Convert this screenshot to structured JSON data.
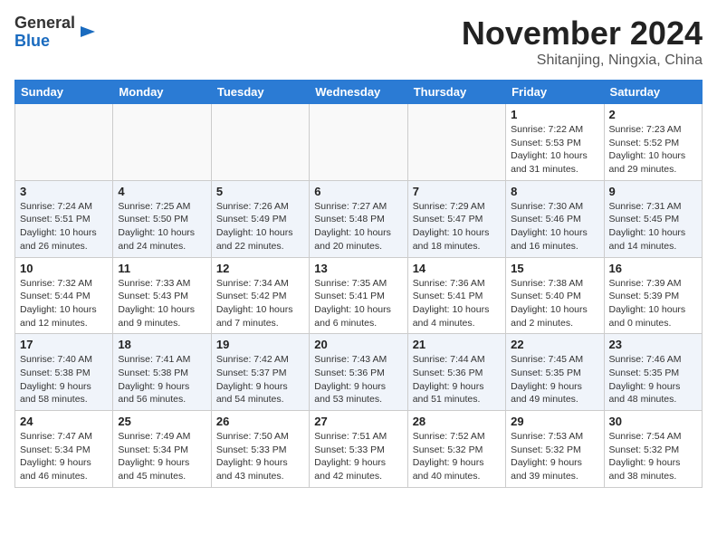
{
  "header": {
    "logo_line1": "General",
    "logo_line2": "Blue",
    "month_year": "November 2024",
    "location": "Shitanjing, Ningxia, China"
  },
  "calendar": {
    "days_of_week": [
      "Sunday",
      "Monday",
      "Tuesday",
      "Wednesday",
      "Thursday",
      "Friday",
      "Saturday"
    ],
    "weeks": [
      [
        {
          "day": "",
          "info": ""
        },
        {
          "day": "",
          "info": ""
        },
        {
          "day": "",
          "info": ""
        },
        {
          "day": "",
          "info": ""
        },
        {
          "day": "",
          "info": ""
        },
        {
          "day": "1",
          "info": "Sunrise: 7:22 AM\nSunset: 5:53 PM\nDaylight: 10 hours and 31 minutes."
        },
        {
          "day": "2",
          "info": "Sunrise: 7:23 AM\nSunset: 5:52 PM\nDaylight: 10 hours and 29 minutes."
        }
      ],
      [
        {
          "day": "3",
          "info": "Sunrise: 7:24 AM\nSunset: 5:51 PM\nDaylight: 10 hours and 26 minutes."
        },
        {
          "day": "4",
          "info": "Sunrise: 7:25 AM\nSunset: 5:50 PM\nDaylight: 10 hours and 24 minutes."
        },
        {
          "day": "5",
          "info": "Sunrise: 7:26 AM\nSunset: 5:49 PM\nDaylight: 10 hours and 22 minutes."
        },
        {
          "day": "6",
          "info": "Sunrise: 7:27 AM\nSunset: 5:48 PM\nDaylight: 10 hours and 20 minutes."
        },
        {
          "day": "7",
          "info": "Sunrise: 7:29 AM\nSunset: 5:47 PM\nDaylight: 10 hours and 18 minutes."
        },
        {
          "day": "8",
          "info": "Sunrise: 7:30 AM\nSunset: 5:46 PM\nDaylight: 10 hours and 16 minutes."
        },
        {
          "day": "9",
          "info": "Sunrise: 7:31 AM\nSunset: 5:45 PM\nDaylight: 10 hours and 14 minutes."
        }
      ],
      [
        {
          "day": "10",
          "info": "Sunrise: 7:32 AM\nSunset: 5:44 PM\nDaylight: 10 hours and 12 minutes."
        },
        {
          "day": "11",
          "info": "Sunrise: 7:33 AM\nSunset: 5:43 PM\nDaylight: 10 hours and 9 minutes."
        },
        {
          "day": "12",
          "info": "Sunrise: 7:34 AM\nSunset: 5:42 PM\nDaylight: 10 hours and 7 minutes."
        },
        {
          "day": "13",
          "info": "Sunrise: 7:35 AM\nSunset: 5:41 PM\nDaylight: 10 hours and 6 minutes."
        },
        {
          "day": "14",
          "info": "Sunrise: 7:36 AM\nSunset: 5:41 PM\nDaylight: 10 hours and 4 minutes."
        },
        {
          "day": "15",
          "info": "Sunrise: 7:38 AM\nSunset: 5:40 PM\nDaylight: 10 hours and 2 minutes."
        },
        {
          "day": "16",
          "info": "Sunrise: 7:39 AM\nSunset: 5:39 PM\nDaylight: 10 hours and 0 minutes."
        }
      ],
      [
        {
          "day": "17",
          "info": "Sunrise: 7:40 AM\nSunset: 5:38 PM\nDaylight: 9 hours and 58 minutes."
        },
        {
          "day": "18",
          "info": "Sunrise: 7:41 AM\nSunset: 5:38 PM\nDaylight: 9 hours and 56 minutes."
        },
        {
          "day": "19",
          "info": "Sunrise: 7:42 AM\nSunset: 5:37 PM\nDaylight: 9 hours and 54 minutes."
        },
        {
          "day": "20",
          "info": "Sunrise: 7:43 AM\nSunset: 5:36 PM\nDaylight: 9 hours and 53 minutes."
        },
        {
          "day": "21",
          "info": "Sunrise: 7:44 AM\nSunset: 5:36 PM\nDaylight: 9 hours and 51 minutes."
        },
        {
          "day": "22",
          "info": "Sunrise: 7:45 AM\nSunset: 5:35 PM\nDaylight: 9 hours and 49 minutes."
        },
        {
          "day": "23",
          "info": "Sunrise: 7:46 AM\nSunset: 5:35 PM\nDaylight: 9 hours and 48 minutes."
        }
      ],
      [
        {
          "day": "24",
          "info": "Sunrise: 7:47 AM\nSunset: 5:34 PM\nDaylight: 9 hours and 46 minutes."
        },
        {
          "day": "25",
          "info": "Sunrise: 7:49 AM\nSunset: 5:34 PM\nDaylight: 9 hours and 45 minutes."
        },
        {
          "day": "26",
          "info": "Sunrise: 7:50 AM\nSunset: 5:33 PM\nDaylight: 9 hours and 43 minutes."
        },
        {
          "day": "27",
          "info": "Sunrise: 7:51 AM\nSunset: 5:33 PM\nDaylight: 9 hours and 42 minutes."
        },
        {
          "day": "28",
          "info": "Sunrise: 7:52 AM\nSunset: 5:32 PM\nDaylight: 9 hours and 40 minutes."
        },
        {
          "day": "29",
          "info": "Sunrise: 7:53 AM\nSunset: 5:32 PM\nDaylight: 9 hours and 39 minutes."
        },
        {
          "day": "30",
          "info": "Sunrise: 7:54 AM\nSunset: 5:32 PM\nDaylight: 9 hours and 38 minutes."
        }
      ]
    ]
  }
}
